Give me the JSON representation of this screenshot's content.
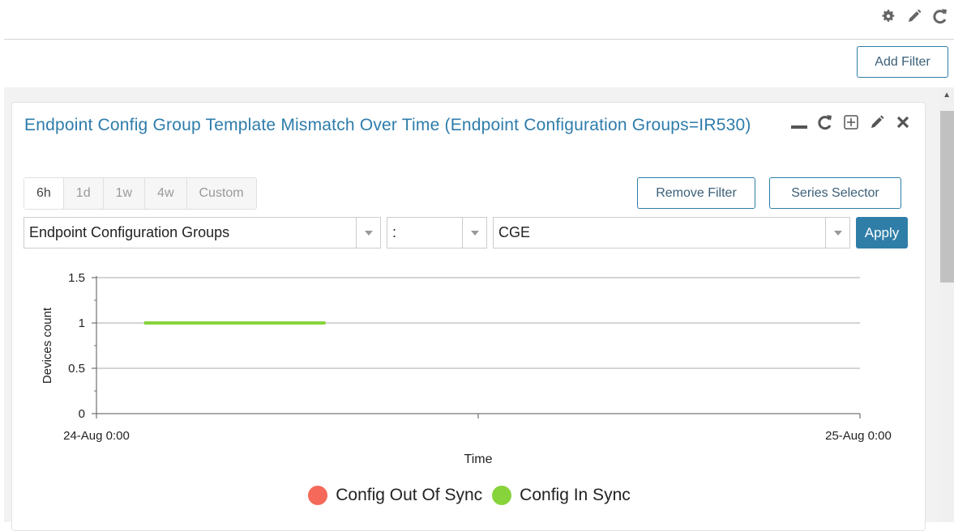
{
  "toolbar": {
    "icons": [
      "gear-icon",
      "pencil-icon",
      "refresh-icon"
    ],
    "add_filter_label": "Add Filter"
  },
  "card": {
    "title": "Endpoint Config Group Template Mismatch Over Time (Endpoint Configuration Groups=IR530)",
    "action_icons": [
      "minimize-icon",
      "refresh-icon",
      "expand-icon",
      "pencil-icon",
      "close-icon"
    ]
  },
  "time_tabs": [
    {
      "label": "6h",
      "active": true
    },
    {
      "label": "1d",
      "active": false
    },
    {
      "label": "1w",
      "active": false
    },
    {
      "label": "4w",
      "active": false
    },
    {
      "label": "Custom",
      "active": false
    }
  ],
  "buttons": {
    "remove_filter": "Remove Filter",
    "series_selector": "Series Selector",
    "apply": "Apply"
  },
  "filters": {
    "group": "Endpoint Configuration Groups",
    "operator": ":",
    "value": "CGE"
  },
  "colors": {
    "accent": "#2f7ea8",
    "title": "#2e7cac",
    "out_of_sync": "#f4695a",
    "in_sync": "#87d33b"
  },
  "chart_data": {
    "type": "line",
    "xlabel": "Time",
    "ylabel": "Devices count",
    "x_tick_labels": [
      "24-Aug 0:00",
      "25-Aug 0:00"
    ],
    "y_ticks": [
      "0",
      "0.5",
      "1",
      "1.5"
    ],
    "ylim": [
      0,
      1.5
    ],
    "xlim_hours": [
      0,
      24
    ],
    "grid": true,
    "legend_position": "bottom",
    "series": [
      {
        "name": "Config Out Of Sync",
        "color": "#f4695a",
        "points": []
      },
      {
        "name": "Config In Sync",
        "color": "#87d33b",
        "points": [
          [
            1.5,
            1
          ],
          [
            7.2,
            1
          ]
        ]
      }
    ]
  }
}
